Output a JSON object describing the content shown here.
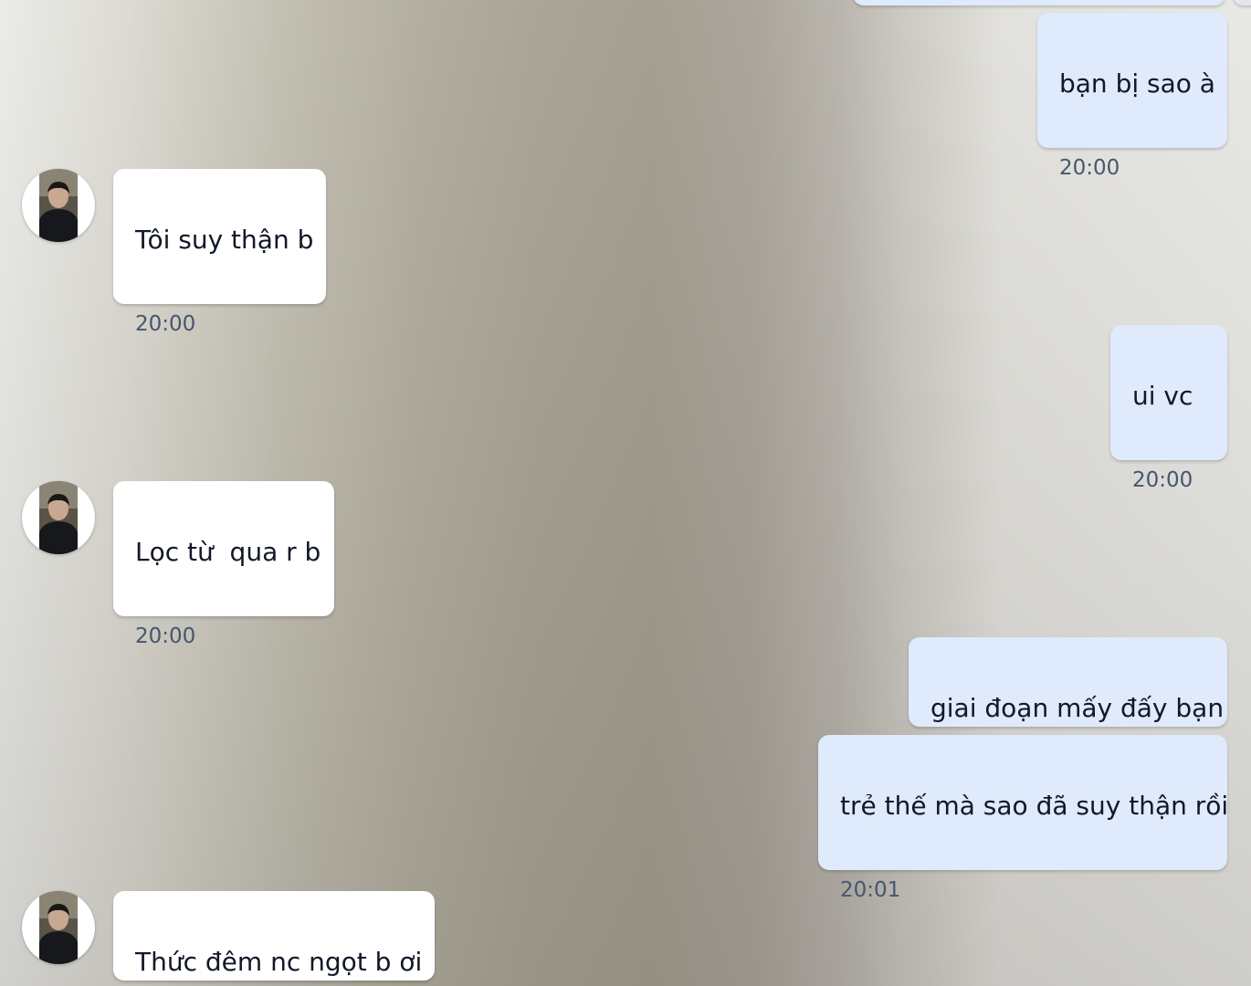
{
  "messages": [
    {
      "side": "out",
      "text": "bạn bị sao à",
      "time": "20:00"
    },
    {
      "side": "in",
      "text": "Tôi suy thận b",
      "time": "20:00"
    },
    {
      "side": "out",
      "text": "ui vc",
      "time": "20:00"
    },
    {
      "side": "in",
      "text": "Lọc từ  qua r b",
      "time": "20:00"
    },
    {
      "side": "out",
      "text": "giai đoạn mấy đấy bạn",
      "time": ""
    },
    {
      "side": "out",
      "text": "trẻ thế mà sao đã suy thận rồi",
      "time": "20:01"
    },
    {
      "side": "in",
      "text": "Thức đêm nc ngọt b ơi",
      "time": ""
    }
  ],
  "colors": {
    "outgoing_bubble": "#dfeafc",
    "incoming_bubble": "#ffffff",
    "timestamp": "#46566f"
  },
  "icons": {
    "avatar": "contact-avatar-photo"
  }
}
